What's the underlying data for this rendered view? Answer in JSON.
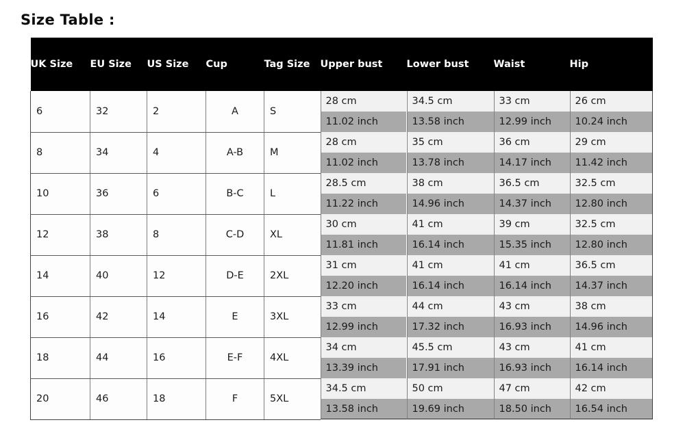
{
  "page": {
    "title": "Size Table :"
  },
  "table": {
    "headers": [
      "UK Size",
      "EU Size",
      "US Size",
      "Cup",
      "Tag Size",
      "Upper bust",
      "Lower bust",
      "Waist",
      "Hip"
    ],
    "rows": [
      {
        "uk_size": "6",
        "eu_size": "32",
        "us_size": "2",
        "cup": "A",
        "tag_size": "S",
        "upper_bust_cm": "28 cm",
        "upper_bust_in": "11.02 inch",
        "lower_bust_cm": "34.5 cm",
        "lower_bust_in": "13.58 inch",
        "waist_cm": "33 cm",
        "waist_in": "12.99 inch",
        "hip_cm": "26 cm",
        "hip_in": "10.24 inch"
      },
      {
        "uk_size": "8",
        "eu_size": "34",
        "us_size": "4",
        "cup": "A-B",
        "tag_size": "M",
        "upper_bust_cm": "28 cm",
        "upper_bust_in": "11.02 inch",
        "lower_bust_cm": "35 cm",
        "lower_bust_in": "13.78 inch",
        "waist_cm": "36 cm",
        "waist_in": "14.17 inch",
        "hip_cm": "29 cm",
        "hip_in": "11.42 inch"
      },
      {
        "uk_size": "10",
        "eu_size": "36",
        "us_size": "6",
        "cup": "B-C",
        "tag_size": "L",
        "upper_bust_cm": "28.5 cm",
        "upper_bust_in": "11.22 inch",
        "lower_bust_cm": "38 cm",
        "lower_bust_in": "14.96 inch",
        "waist_cm": "36.5 cm",
        "waist_in": "14.37 inch",
        "hip_cm": "32.5 cm",
        "hip_in": "12.80 inch"
      },
      {
        "uk_size": "12",
        "eu_size": "38",
        "us_size": "8",
        "cup": "C-D",
        "tag_size": "XL",
        "upper_bust_cm": "30 cm",
        "upper_bust_in": "11.81 inch",
        "lower_bust_cm": "41 cm",
        "lower_bust_in": "16.14 inch",
        "waist_cm": "39 cm",
        "waist_in": "15.35 inch",
        "hip_cm": "32.5 cm",
        "hip_in": "12.80 inch"
      },
      {
        "uk_size": "14",
        "eu_size": "40",
        "us_size": "12",
        "cup": "D-E",
        "tag_size": "2XL",
        "upper_bust_cm": "31 cm",
        "upper_bust_in": "12.20 inch",
        "lower_bust_cm": "41 cm",
        "lower_bust_in": "16.14 inch",
        "waist_cm": "41 cm",
        "waist_in": "16.14 inch",
        "hip_cm": "36.5 cm",
        "hip_in": "14.37 inch"
      },
      {
        "uk_size": "16",
        "eu_size": "42",
        "us_size": "14",
        "cup": "E",
        "tag_size": "3XL",
        "upper_bust_cm": "33 cm",
        "upper_bust_in": "12.99 inch",
        "lower_bust_cm": "44 cm",
        "lower_bust_in": "17.32 inch",
        "waist_cm": "43 cm",
        "waist_in": "16.93 inch",
        "hip_cm": "38 cm",
        "hip_in": "14.96 inch"
      },
      {
        "uk_size": "18",
        "eu_size": "44",
        "us_size": "16",
        "cup": "E-F",
        "tag_size": "4XL",
        "upper_bust_cm": "34 cm",
        "upper_bust_in": "13.39 inch",
        "lower_bust_cm": "45.5 cm",
        "lower_bust_in": "17.91 inch",
        "waist_cm": "43 cm",
        "waist_in": "16.93 inch",
        "hip_cm": "41 cm",
        "hip_in": "16.14 inch"
      },
      {
        "uk_size": "20",
        "eu_size": "46",
        "us_size": "18",
        "cup": "F",
        "tag_size": "5XL",
        "upper_bust_cm": "34.5 cm",
        "upper_bust_in": "13.58 inch",
        "lower_bust_cm": "50 cm",
        "lower_bust_in": "19.69 inch",
        "waist_cm": "47 cm",
        "waist_in": "18.50 inch",
        "hip_cm": "42 cm",
        "hip_in": "16.54 inch"
      }
    ]
  },
  "colors": {
    "header_bg": "#000000",
    "header_text": "#ffffff",
    "cm_row_bg": "#f1f1f1",
    "inch_row_bg": "#a9a9a9",
    "size_cell_bg": "#fdfdfd",
    "text": "#1a1a1a"
  }
}
